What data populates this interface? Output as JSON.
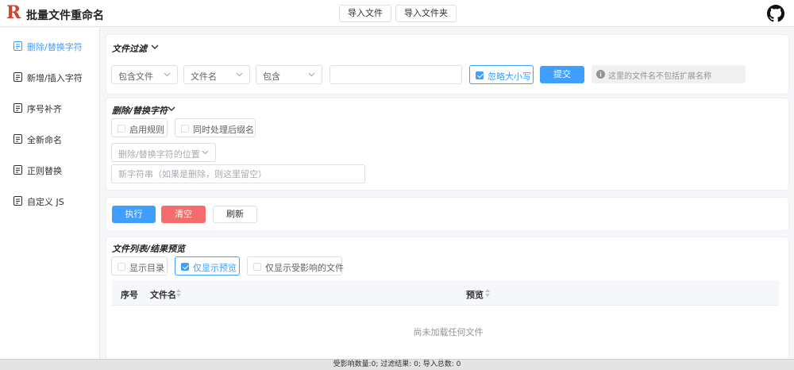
{
  "header": {
    "logo_letter": "R",
    "title": "批量文件重命名",
    "import_file": "导入文件",
    "import_folder": "导入文件夹"
  },
  "sidebar": {
    "items": [
      {
        "label": "删除/替换字符",
        "active": true
      },
      {
        "label": "新增/插入字符",
        "active": false
      },
      {
        "label": "序号补齐",
        "active": false
      },
      {
        "label": "全新命名",
        "active": false
      },
      {
        "label": "正则替换",
        "active": false
      },
      {
        "label": "自定义 JS",
        "active": false
      }
    ]
  },
  "filter": {
    "title": "文件过滤",
    "select1": "包含文件",
    "select2": "文件名",
    "select3": "包含",
    "text_value": "",
    "ignore_case": "忽略大小写",
    "submit": "提交",
    "hint": "这里的文件名不包括扩展名称"
  },
  "replace": {
    "title": "删除/替换字符",
    "enable_rule": "启用规则",
    "with_ext": "同时处理后缀名",
    "position_placeholder": "删除/替换字符的位置",
    "new_string_placeholder": "新字符串（如果是删除，则这里留空）"
  },
  "actions": {
    "execute": "执行",
    "clear": "清空",
    "refresh": "刷新"
  },
  "filelist": {
    "title": "文件列表/结果预览",
    "show_dir": "显示目录",
    "only_preview": "仅显示预览",
    "only_affected": "仅显示受影响的文件",
    "col_index": "序号",
    "col_name": "文件名",
    "col_preview": "预览",
    "empty": "尚未加载任何文件"
  },
  "footer": {
    "status": "受影响数量:0; 过滤结果: 0; 导入总数: 0"
  },
  "colors": {
    "primary": "#409eff",
    "danger": "#f56c6c",
    "logo": "#d0462b"
  },
  "icons": {
    "sidebar_item": "document-list-icon",
    "github": "github-icon",
    "info": "info-icon"
  }
}
